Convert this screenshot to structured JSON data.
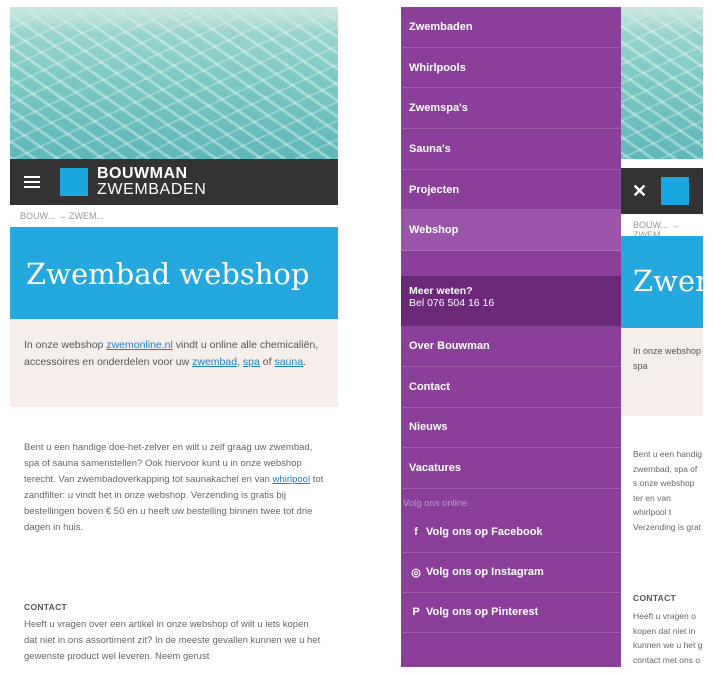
{
  "left_screen": {
    "header": {
      "logo_line1": "BOUWMAN",
      "logo_line2": "ZWEMBADEN",
      "menu_icon": "hamburger-icon"
    },
    "breadcrumb": "BOUW... → ZWEM...",
    "title": "Zwembad webshop",
    "intro": {
      "text_before": "In onze webshop ",
      "link_webshop": "zwemonline.nl",
      "text_mid": " vindt u online alle chemicaliën, accessoires en onderdelen voor uw ",
      "link_zwembad": "zwembad",
      "sep1": ", ",
      "link_spa": "spa",
      "sep2": " of ",
      "link_sauna": "sauna",
      "end": "."
    },
    "body": {
      "text_before": "Bent u een handige doe-het-zelver en wilt u zelf graag uw zwembad, spa of sauna samenstellen? Ook hiervoor kunt u in onze webshop terecht. Van zwembadoverkapping tot saunakachel en van ",
      "link_whirlpool": "whirlpool",
      "text_after": " tot zandfilter: u vindt het in onze webshop. Verzending is gratis bij bestellingen boven € 50 en u heeft uw bestelling binnen twee tot drie dagen in huis."
    },
    "contact": {
      "label": "CONTACT",
      "text": "Heeft u vragen over een artikel in onze webshop of wilt u iets kopen dat niet in ons assortiment zit? In de meeste gevallen kunnen we u het gewenste product wel leveren. Neem gerust"
    }
  },
  "right_screen": {
    "menu": {
      "items": [
        "Zwembaden",
        "Whirlpools",
        "Zwemspa's",
        "Sauna's",
        "Projecten",
        "Webshop"
      ],
      "active_index": 5,
      "meer_weten": {
        "title": "Meer weten?",
        "phone": "Bel 076 504 16 16"
      },
      "secondary_items": [
        "Over Bouwman",
        "Contact",
        "Nieuws",
        "Vacatures"
      ],
      "follow_label": "Volg ons online",
      "social": [
        {
          "label": "Volg ons op Facebook",
          "icon": "facebook-icon",
          "glyph": "f"
        },
        {
          "label": "Volg ons op Instagram",
          "icon": "instagram-icon",
          "glyph": "◎"
        },
        {
          "label": "Volg ons op Pinterest",
          "icon": "pinterest-icon",
          "glyph": "P"
        }
      ]
    },
    "peek": {
      "close_icon": "close-icon",
      "logo_initial": "",
      "breadcrumb": "BOUW... → ZWEM...",
      "title": "Zwem",
      "intro": "In onze webshop chemicaliën, ac zwembad, spa",
      "body": "Bent u een handig zwembad, spa of s onze webshop ter en van whirlpool t Verzending is grat bestelling binnen",
      "contact_label": "CONTACT",
      "contact_text": "Heeft u vragen o kopen dat niet in kunnen we u het g contact met ons o"
    }
  },
  "colors": {
    "brand_blue": "#24a8dd",
    "header_dark": "#333333",
    "menu_purple": "#8a3f98",
    "menu_dark_purple": "#6a2a78",
    "intro_bg": "#f6eeea"
  }
}
